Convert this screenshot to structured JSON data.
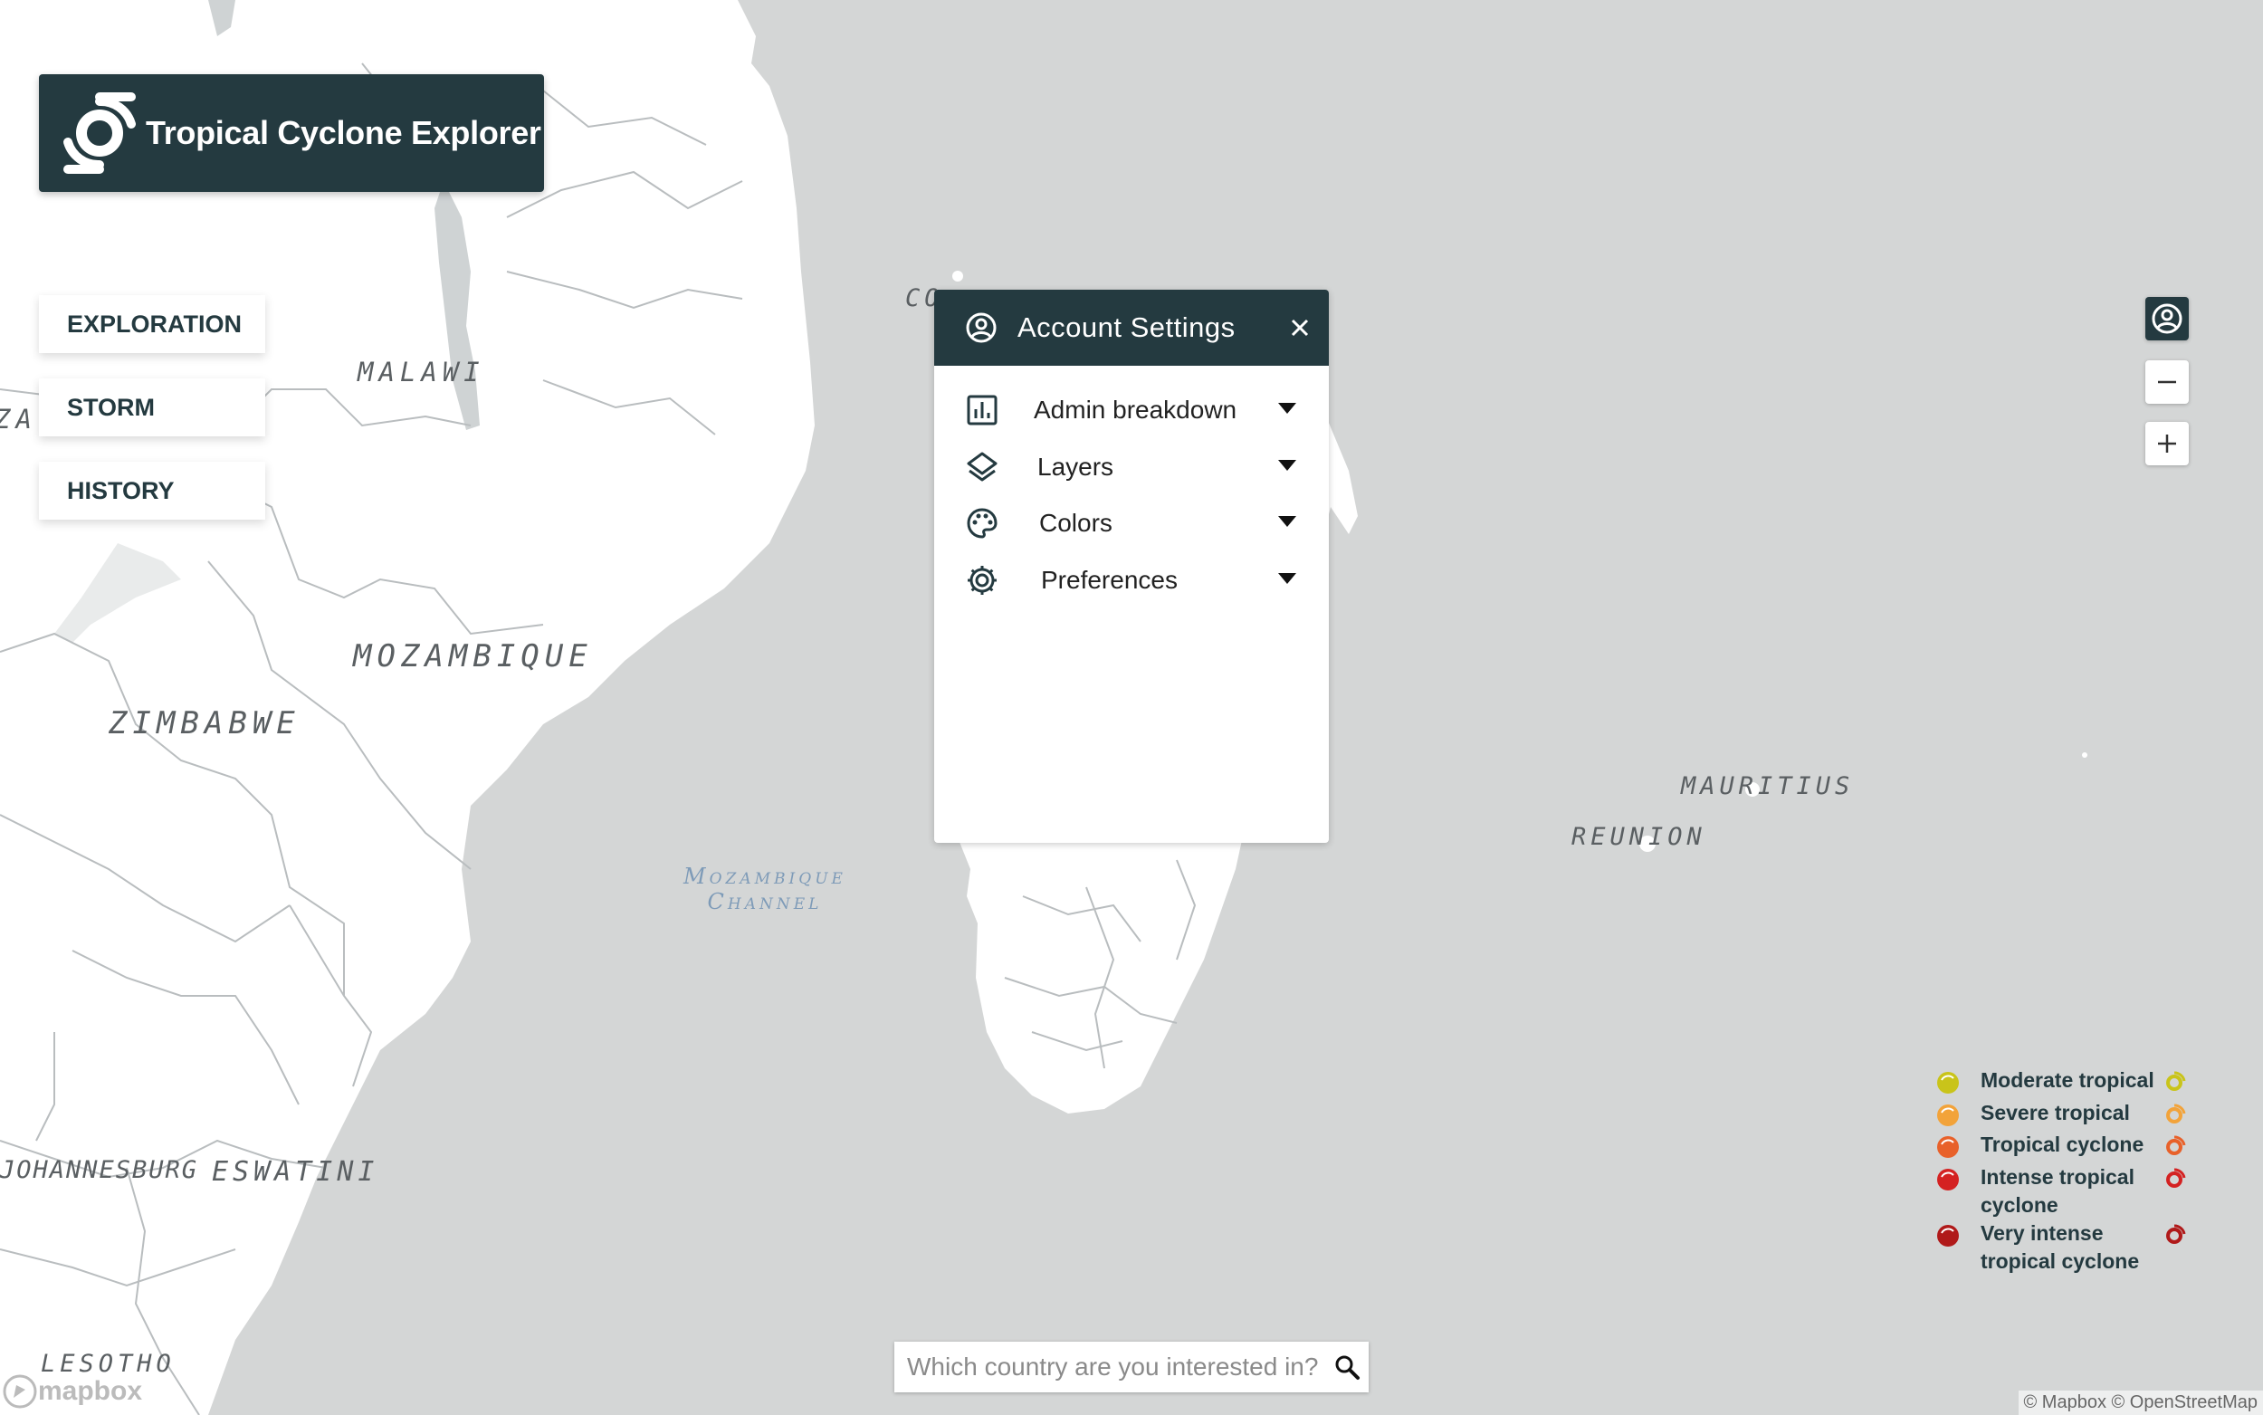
{
  "app": {
    "title": "Tropical Cyclone Explorer"
  },
  "nav": {
    "items": [
      {
        "label": "EXPLORATION"
      },
      {
        "label": "STORM"
      },
      {
        "label": "HISTORY"
      }
    ]
  },
  "map_labels": {
    "malawi": "MALAWI",
    "mozambique": "MOZAMBIQUE",
    "zimbabwe": "ZIMBABWE",
    "za": "ZA",
    "johannesburg": "JOHANNESBURG",
    "eswatini": "ESWATINI",
    "lesotho": "LESOTHO",
    "comoros": "CO",
    "mauritius": "MAURITIUS",
    "reunion": "REUNION",
    "channel_line1": "Mozambique",
    "channel_line2": "Channel"
  },
  "panel": {
    "title": "Account Settings",
    "rows": [
      {
        "label": "Admin breakdown",
        "icon": "chart-icon"
      },
      {
        "label": "Layers",
        "icon": "layers-icon"
      },
      {
        "label": "Colors",
        "icon": "palette-icon"
      },
      {
        "label": "Preferences",
        "icon": "gear-icon"
      }
    ]
  },
  "legend": {
    "items": [
      {
        "label": "Moderate tropical",
        "color": "#c9c41a"
      },
      {
        "label": "Severe tropical",
        "color": "#f2a33a"
      },
      {
        "label": "Tropical cyclone",
        "color": "#e8612a"
      },
      {
        "label": "Intense tropical cyclone",
        "color": "#d42222"
      },
      {
        "label": "Very intense tropical cyclone",
        "color": "#b01a1a"
      }
    ]
  },
  "search": {
    "placeholder": "Which country are you interested in?"
  },
  "attribution": "© Mapbox © OpenStreetMap",
  "mapbox_logo": "mapbox",
  "colors": {
    "header_bg": "#243a40",
    "sea": "#d4d6d6",
    "land": "#ffffff"
  }
}
